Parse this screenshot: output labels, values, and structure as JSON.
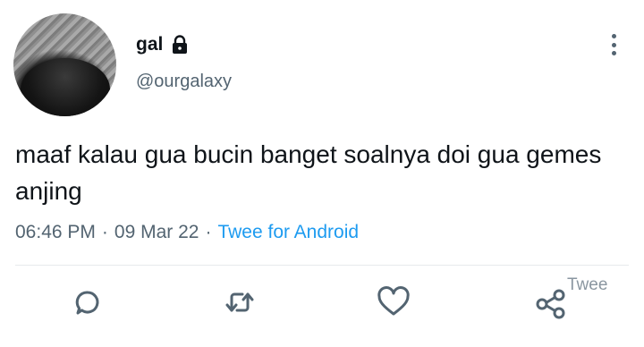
{
  "tweet": {
    "display_name": "gal",
    "handle": "@ourgalaxy",
    "text": "maaf kalau gua bucin banget soalnya doi gua gemes anjing",
    "time": "06:46 PM",
    "separator": "·",
    "date": "09 Mar 22",
    "client": "Twee for Android"
  },
  "actions": {
    "share_label": "Twee"
  },
  "icons": {
    "lock": "lock-icon",
    "more": "more-vertical-icon",
    "reply": "reply-icon",
    "retweet": "retweet-icon",
    "like": "heart-icon",
    "share": "share-icon"
  },
  "colors": {
    "text": "#0f1419",
    "muted": "#536471",
    "link": "#1d9bf0"
  }
}
